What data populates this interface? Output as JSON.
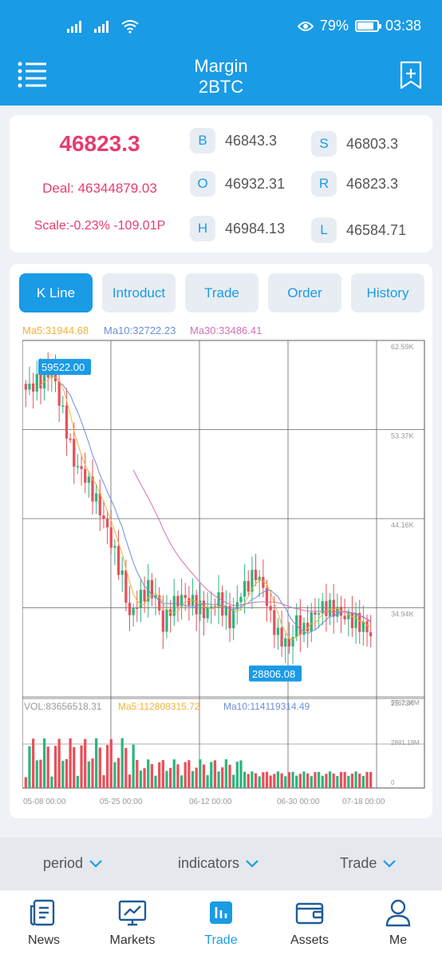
{
  "status": {
    "battery": "79%",
    "time": "03:38"
  },
  "header": {
    "title": "Margin",
    "subtitle": "2BTC"
  },
  "ticker": {
    "last_price": "46823.3",
    "deal": "Deal: 46344879.03",
    "scale": "Scale:-0.23% -109.01P",
    "stats": [
      {
        "key": "B",
        "value": "46843.3"
      },
      {
        "key": "S",
        "value": "46803.3"
      },
      {
        "key": "O",
        "value": "46932.31"
      },
      {
        "key": "R",
        "value": "46823.3"
      },
      {
        "key": "H",
        "value": "46984.13"
      },
      {
        "key": "L",
        "value": "46584.71"
      }
    ]
  },
  "tabs": [
    "K Line",
    "Introduct",
    "Trade",
    "Order",
    "History"
  ],
  "active_tab": "K Line",
  "ma": {
    "ma5": "Ma5:31944.68",
    "ma10": "Ma10:32722.23",
    "ma30": "Ma30:33486.41"
  },
  "vol_labels": {
    "vol": "VOL:83656518.31",
    "ma5": "Ma5:112808315.72",
    "ma10": "Ma10:114119314.49"
  },
  "colors": {
    "brand": "#1a9be6",
    "up": "#2cb57e",
    "down": "#e8505b",
    "ma5": "#f0b23c",
    "ma10": "#6c8fd6",
    "ma30": "#d46fb5"
  },
  "chart_data": {
    "type": "candlestick",
    "y_ticks": [
      "62.59K",
      "53.37K",
      "44.16K",
      "34.94K",
      "25.73K"
    ],
    "vol_ticks": [
      "5762.38M",
      "2881.19M",
      "0"
    ],
    "x_ticks": [
      "05-08 00:00",
      "05-25 00:00",
      "06-12 00:00",
      "06-30 00:00",
      "07-18 00:00"
    ],
    "max_label": "59522.00",
    "min_label": "28806.08",
    "ylim": [
      25730,
      62590
    ],
    "vol_max": 5762.38
  },
  "footer": {
    "period": "period",
    "indicators": "indicators",
    "trade": "Trade"
  },
  "nav": [
    {
      "label": "News",
      "icon": "news-icon"
    },
    {
      "label": "Markets",
      "icon": "markets-icon"
    },
    {
      "label": "Trade",
      "icon": "trade-icon"
    },
    {
      "label": "Assets",
      "icon": "wallet-icon"
    },
    {
      "label": "Me",
      "icon": "user-icon"
    }
  ]
}
